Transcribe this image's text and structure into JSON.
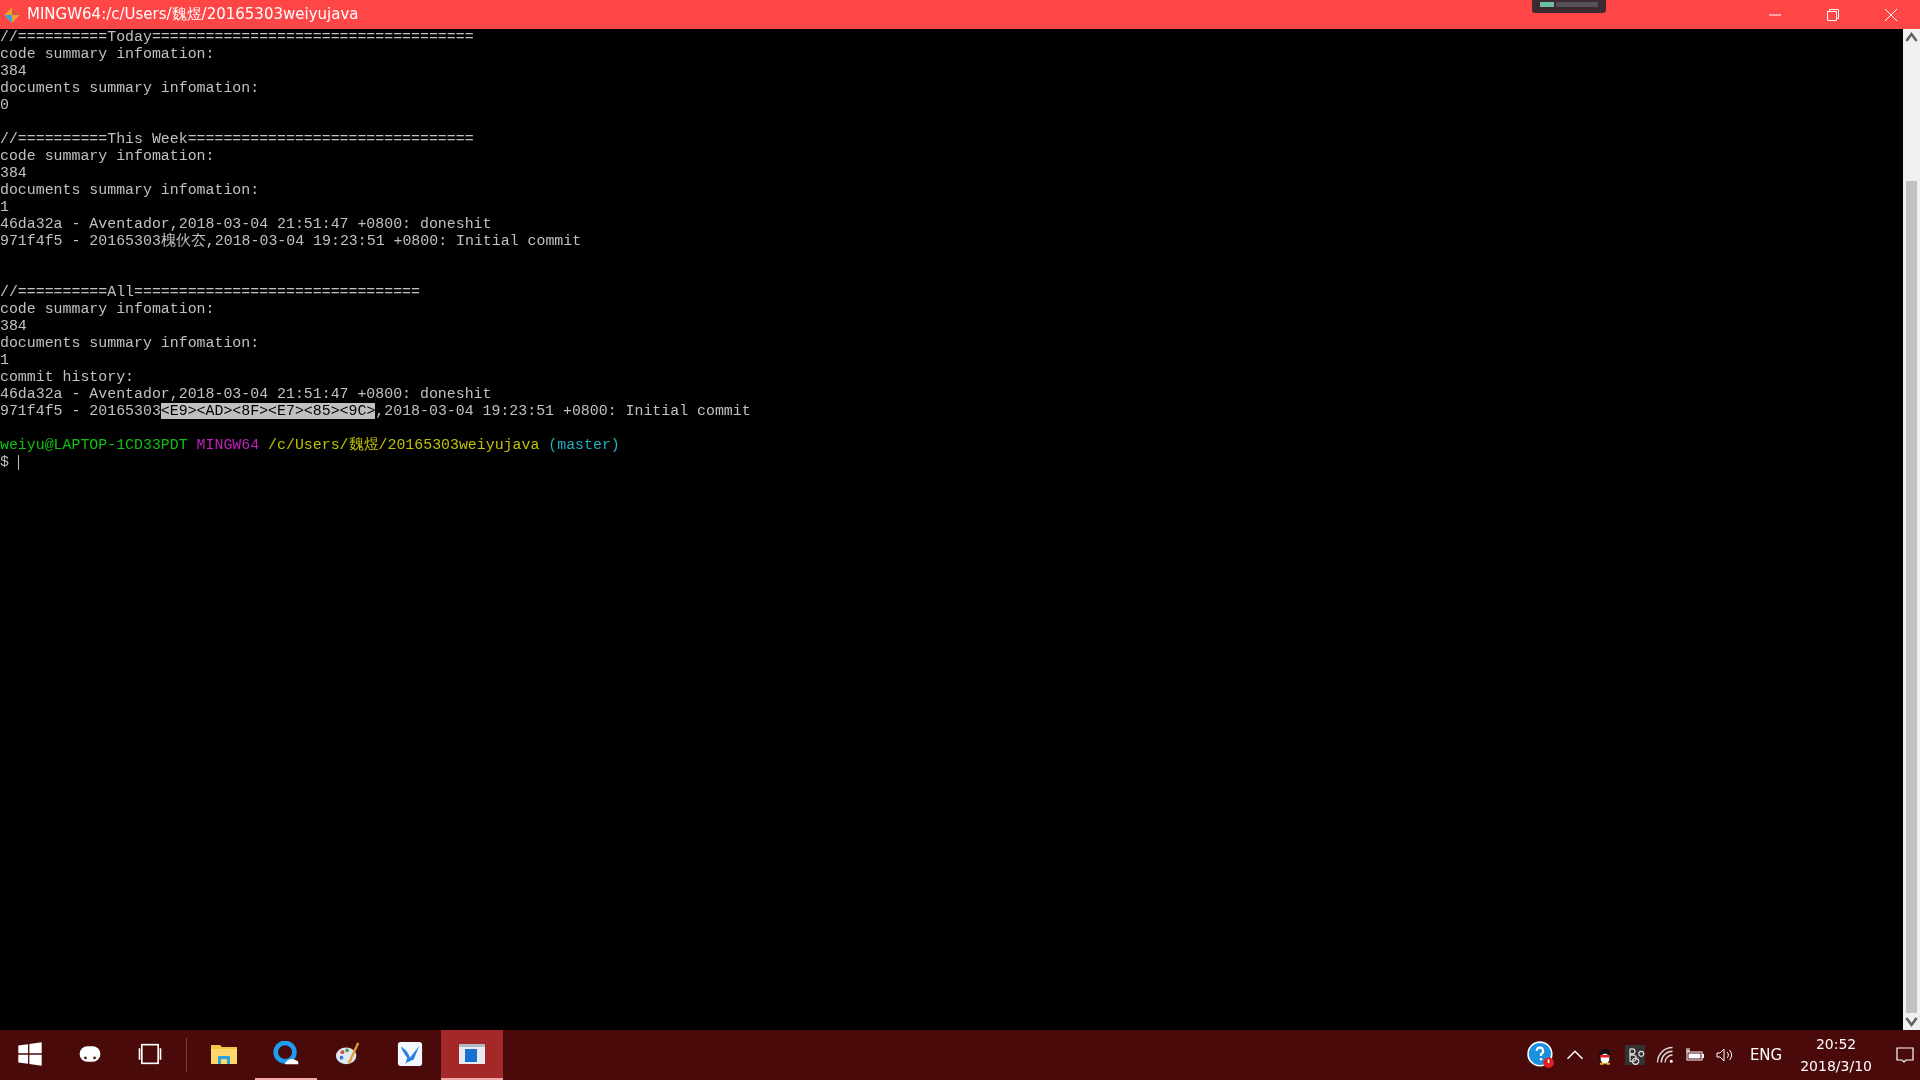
{
  "window": {
    "title": "MINGW64:/c/Users/魏煜/20165303weiyujava"
  },
  "terminal": {
    "lines": [
      {
        "kind": "output",
        "text": "//==========Today===================================="
      },
      {
        "kind": "output",
        "text": "code summary infomation:"
      },
      {
        "kind": "output",
        "text": "384"
      },
      {
        "kind": "output",
        "text": "documents summary infomation:"
      },
      {
        "kind": "output",
        "text": "0"
      },
      {
        "kind": "blank"
      },
      {
        "kind": "output",
        "text": "//==========This Week================================"
      },
      {
        "kind": "output",
        "text": "code summary infomation:"
      },
      {
        "kind": "output",
        "text": "384"
      },
      {
        "kind": "output",
        "text": "documents summary infomation:"
      },
      {
        "kind": "output",
        "text": "1"
      },
      {
        "kind": "output",
        "text": "46da32a - Aventador,2018-03-04 21:51:47 +0800: doneshit"
      },
      {
        "kind": "output",
        "text": "971f4f5 - 20165303槐伙厺,2018-03-04 19:23:51 +0800: Initial commit"
      },
      {
        "kind": "blank"
      },
      {
        "kind": "blank"
      },
      {
        "kind": "output",
        "text": "//==========All================================"
      },
      {
        "kind": "output",
        "text": "code summary infomation:"
      },
      {
        "kind": "output",
        "text": "384"
      },
      {
        "kind": "output",
        "text": "documents summary infomation:"
      },
      {
        "kind": "output",
        "text": "1"
      },
      {
        "kind": "output",
        "text": "commit history:"
      },
      {
        "kind": "output",
        "text": "46da32a - Aventador,2018-03-04 21:51:47 +0800: doneshit"
      },
      {
        "kind": "mixed",
        "segments": [
          {
            "kind": "plain",
            "text": "971f4f5 - 20165303"
          },
          {
            "kind": "selected",
            "text": "<E9><AD><8F><E7><85><9C>"
          },
          {
            "kind": "plain",
            "text": ",2018-03-04 19:23:51 +0800: Initial commit"
          }
        ]
      },
      {
        "kind": "blank"
      },
      {
        "kind": "mixed",
        "segments": [
          {
            "kind": "user",
            "text": "weiyu@LAPTOP-1CD33PDT"
          },
          {
            "kind": "host",
            "text": "MINGW64"
          },
          {
            "kind": "path",
            "text": "/c/Users/魏煜/20165303weiyujava"
          },
          {
            "kind": "branch",
            "text": "(master)"
          }
        ]
      },
      {
        "kind": "input",
        "text": "$"
      }
    ]
  },
  "taskbar": {
    "apps": [
      {
        "kind": "start",
        "active": false
      },
      {
        "kind": "cortana",
        "active": false
      },
      {
        "kind": "taskview",
        "active": false
      },
      {
        "kind": "folder",
        "active": false
      },
      {
        "kind": "browser",
        "active": true
      },
      {
        "kind": "paint",
        "active": false
      },
      {
        "kind": "bird",
        "active": false
      },
      {
        "kind": "window",
        "active": true
      }
    ],
    "tray": {
      "language": "ENG",
      "time": "20:52",
      "date": "2018/3/10"
    }
  }
}
